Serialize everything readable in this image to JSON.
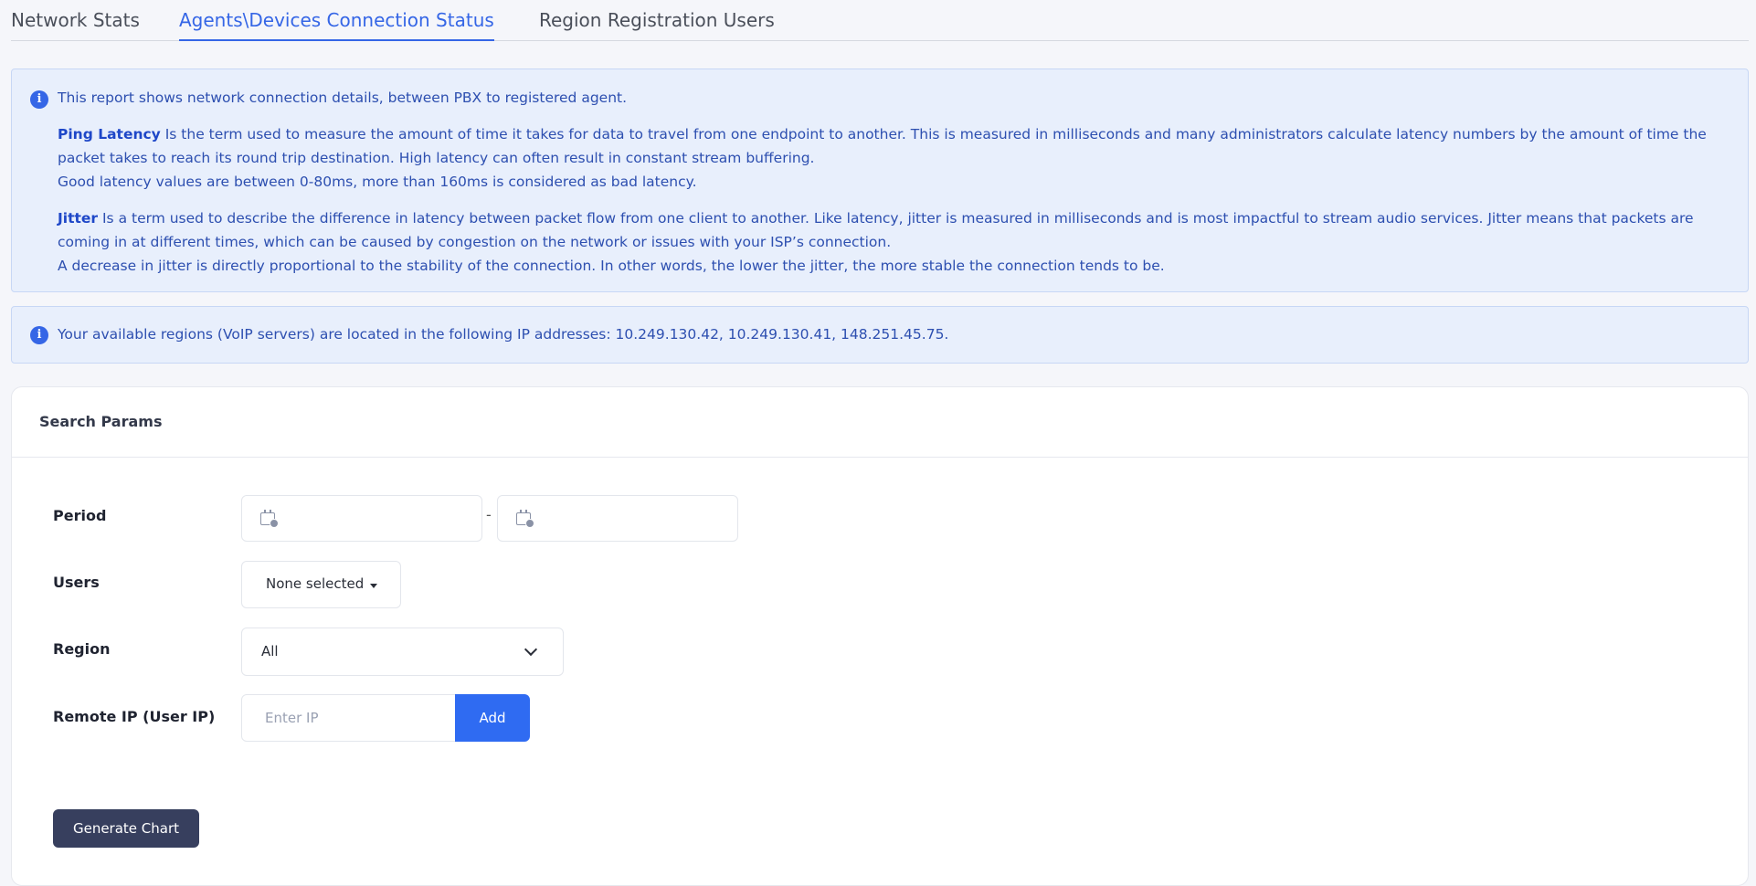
{
  "tabs": [
    {
      "label": "Network Stats"
    },
    {
      "label": "Agents\\Devices Connection Status"
    },
    {
      "label": "Region Registration Users"
    }
  ],
  "info1": {
    "intro": "This report shows network connection details, between PBX to registered agent.",
    "ping_term": "Ping Latency",
    "ping_desc": " Is the term used to measure the amount of time it takes for data to travel from one endpoint to another. This is measured in milliseconds and many administrators calculate latency numbers by the amount of time the packet takes to reach its round trip destination. High latency can often result in constant stream buffering.",
    "ping_good": "Good latency values are between 0-80ms, more than 160ms is considered as bad latency.",
    "jitter_term": "Jitter",
    "jitter_desc": " Is a term used to describe the difference in latency between packet flow from one client to another. Like latency, jitter is measured in milliseconds and is most impactful to stream audio services. Jitter means that packets are coming in at different times, which can be caused by congestion on the network or issues with your ISP’s connection.",
    "jitter_note": "A decrease in jitter is directly proportional to the stability of the connection. In other words, the lower the jitter, the more stable the connection tends to be."
  },
  "info2": {
    "text": "Your available regions (VoIP servers) are located in the following IP addresses: 10.249.130.42, 10.249.130.41, 148.251.45.75."
  },
  "search": {
    "title": "Search Params",
    "period_label": "Period",
    "period_dash": "-",
    "users_label": "Users",
    "users_value": "None selected",
    "region_label": "Region",
    "region_value": "All",
    "remote_ip_label": "Remote IP (User IP)",
    "ip_placeholder": "Enter IP",
    "add_label": "Add",
    "generate_label": "Generate Chart"
  },
  "colors": {
    "accent": "#3566e6",
    "info_bg": "#e8effc",
    "generate_btn": "#373f5e",
    "add_btn": "#2f6bf2"
  }
}
